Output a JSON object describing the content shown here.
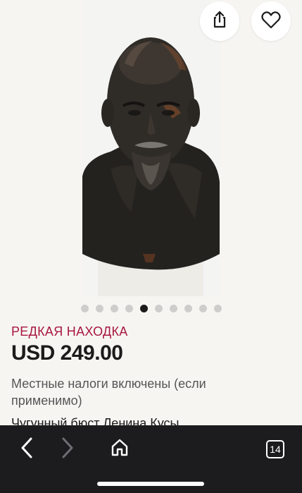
{
  "product": {
    "badge": "РЕДКАЯ НАХОДКА",
    "price": "USD 249.00",
    "tax_note": "Местные налоги включены (если применимо)",
    "title_partial": "Чугунный бюст Ленина Кусы"
  },
  "carousel": {
    "total": 10,
    "active_index": 4
  },
  "actions": {
    "share_icon": "share-icon",
    "favorite_icon": "heart-icon"
  },
  "browser": {
    "tab_count": "14",
    "icons": [
      "chevron-left-icon",
      "chevron-right-icon",
      "home-icon",
      "tabs-icon"
    ]
  },
  "colors": {
    "badge": "#a8173f",
    "background": "#f7f5f2",
    "toolbar": "#1c1c1e"
  }
}
